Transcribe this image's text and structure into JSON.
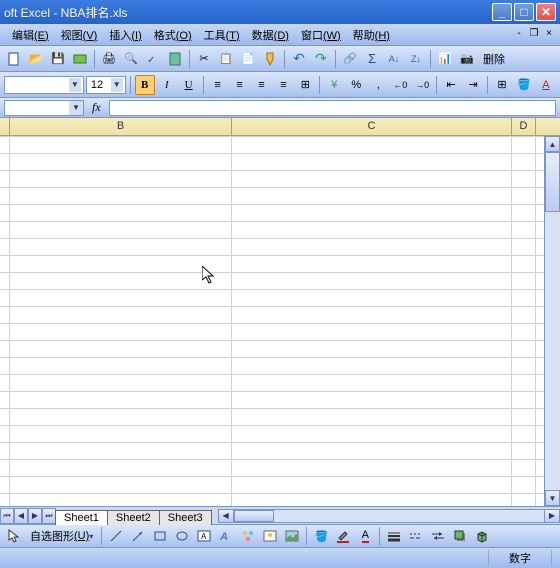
{
  "title": "oft Excel - NBA排名.xls",
  "menu": {
    "edit": "编辑",
    "edit_k": "(E)",
    "view": "视图",
    "view_k": "(V)",
    "insert": "插入",
    "insert_k": "(I)",
    "format": "格式",
    "format_k": "(O)",
    "tools": "工具",
    "tools_k": "(T)",
    "data": "数据",
    "data_k": "(D)",
    "window": "窗口",
    "window_k": "(W)",
    "help": "帮助",
    "help_k": "(H)"
  },
  "toolbar": {
    "delete_cn": "删除"
  },
  "format": {
    "font_size": "12",
    "bold": "B",
    "italic": "I",
    "underline": "U",
    "percent": "%",
    "comma": ","
  },
  "formula_bar": {
    "fx": "fx"
  },
  "columns": {
    "B": "B",
    "C": "C",
    "D": "D"
  },
  "sheets": {
    "s1": "Sheet1",
    "s2": "Sheet2",
    "s3": "Sheet3"
  },
  "drawing": {
    "autoshapes": "自选图形",
    "autoshapes_k": "(U)"
  },
  "status": {
    "numlock": "数字"
  },
  "icons": {
    "open": "📂",
    "save": "💾",
    "print": "🖨",
    "preview": "🔍",
    "cut": "✂",
    "copy": "📋",
    "paste": "📄",
    "undo": "↶",
    "redo": "↷",
    "hyperlink": "🔗",
    "sum": "Σ",
    "sort_asc": "A↓",
    "sort_desc": "Z↓",
    "chart": "📊",
    "camera": "📷",
    "align_l": "≡",
    "align_c": "≡",
    "align_r": "≡",
    "align_j": "≡",
    "merge": "⊞",
    "currency": "¥",
    "dec_inc": "←0",
    "dec_dec": "→0",
    "indent_dec": "⇤",
    "indent_inc": "⇥",
    "border": "⊞",
    "fill": "🪣",
    "font_color": "A"
  }
}
